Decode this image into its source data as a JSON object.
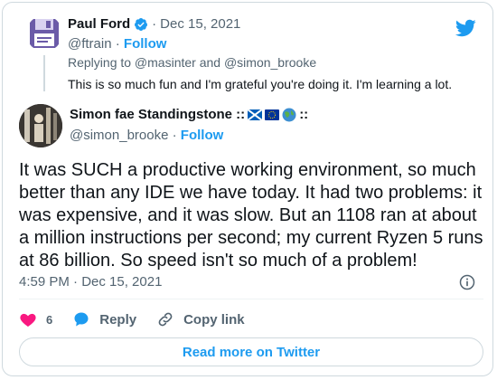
{
  "parent": {
    "name": "Paul Ford",
    "date": "Dec 15, 2021",
    "handle": "@ftrain",
    "follow_label": "Follow",
    "replying": "Replying to @masinter and @simon_brooke",
    "text": "This is so much fun and I'm grateful you're doing it. I'm learning a lot."
  },
  "main": {
    "name": "Simon fae Standingstone ::",
    "name_suffix": "::",
    "flags": [
      "scotland-flag",
      "eu-flag",
      "globe-emoji"
    ],
    "handle": "@simon_brooke",
    "follow_label": "Follow",
    "text": "It was SUCH a productive working environment, so much better than any IDE we have today. It had two problems: it was expensive, and it was slow. But an 1108 ran at about a million instructions per second; my current Ryzen 5 runs at 86 billion. So speed isn't so much of a problem!",
    "timestamp": "4:59 PM · Dec 15, 2021"
  },
  "actions": {
    "like_count": "6",
    "reply_label": "Reply",
    "copy_label": "Copy link"
  },
  "read_more": "Read more on Twitter",
  "colors": {
    "accent": "#1d9bf0",
    "like": "#f91880",
    "muted": "#536471"
  }
}
